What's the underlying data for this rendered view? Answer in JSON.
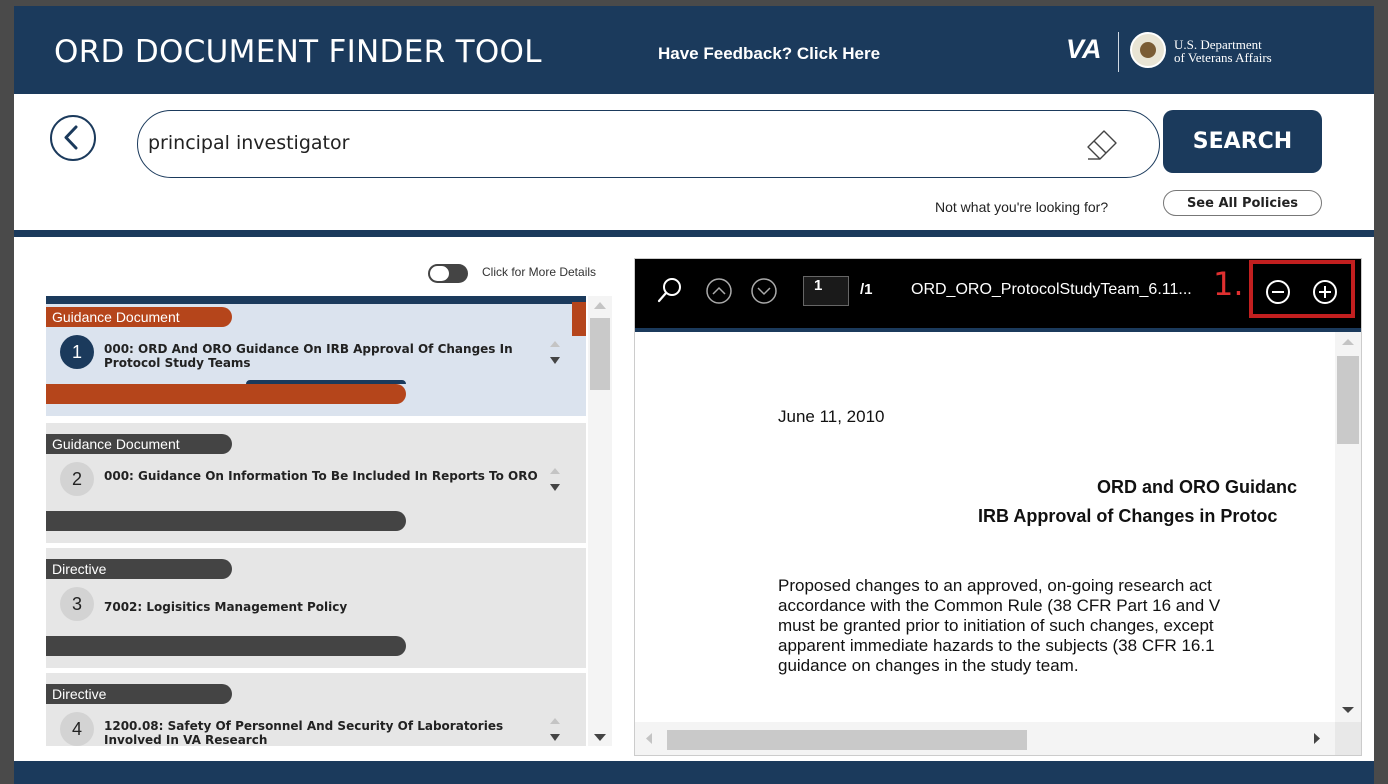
{
  "header": {
    "title": "ORD DOCUMENT FINDER TOOL",
    "feedback_link": "Have Feedback? Click Here",
    "va_logo": "VA",
    "department_line1": "U.S. Department",
    "department_line2": "of Veterans Affairs"
  },
  "search": {
    "value": "principal investigator",
    "button_label": "SEARCH",
    "not_found_text": "Not what you're looking for?",
    "see_all_label": "See All Policies"
  },
  "details_toggle": {
    "label": "Click for More Details",
    "on": false
  },
  "results": [
    {
      "type": "Guidance Document",
      "number": "1",
      "title": "000: ORD And ORO Guidance On IRB Approval Of Changes In Protocol Study Teams",
      "selected": true
    },
    {
      "type": "Guidance Document",
      "number": "2",
      "title": "000: Guidance On Information To Be Included In Reports To ORO",
      "selected": false
    },
    {
      "type": "Directive",
      "number": "3",
      "title": "7002: Logisitics Management Policy",
      "selected": false
    },
    {
      "type": "Directive",
      "number": "4",
      "title": "1200.08: Safety Of Personnel And Security Of Laboratories Involved In VA Research",
      "selected": false
    }
  ],
  "viewer": {
    "page_current": "1",
    "page_total": "/1",
    "doc_name": "ORD_ORO_ProtocolStudyTeam_6.11...",
    "annotation_label": "1.",
    "page": {
      "date": "June 11, 2010",
      "title_line1": "ORD and ORO Guidanc",
      "title_line2": "IRB Approval of Changes in Protoc",
      "body": [
        "Proposed changes to an approved, on-going research act",
        "accordance with the Common Rule (38 CFR Part 16 and V",
        "must be granted prior to initiation of such changes, except",
        "apparent immediate hazards to the subjects (38 CFR 16.1",
        "guidance on changes in the study team."
      ]
    }
  },
  "colors": {
    "navy": "#1b3a5c",
    "accent_orange": "#b5451b",
    "annotation_red": "#c21f1f"
  }
}
